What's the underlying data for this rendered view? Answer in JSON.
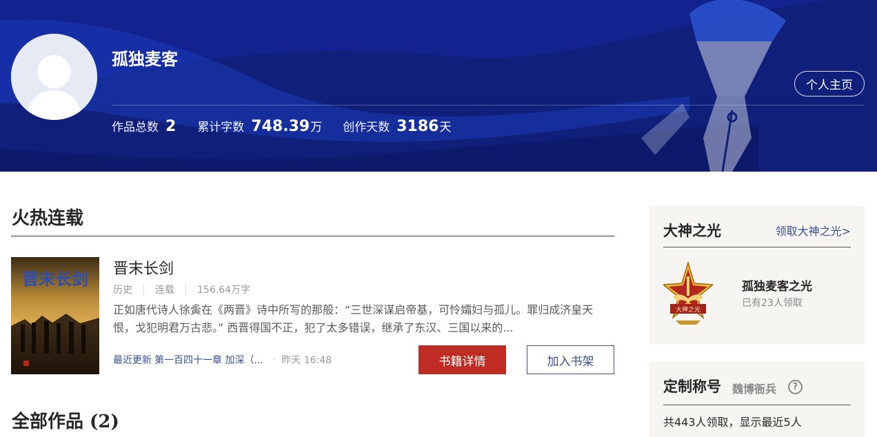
{
  "author": {
    "name": "孤独麦客",
    "home_button": "个人主页",
    "stats": [
      {
        "label": "作品总数",
        "value": "2",
        "unit": ""
      },
      {
        "label": "累计字数",
        "value": "748.39",
        "unit": "万"
      },
      {
        "label": "创作天数",
        "value": "3186",
        "unit": "天"
      }
    ]
  },
  "hot": {
    "title": "火热连载",
    "book": {
      "title": "晋末长剑",
      "category": "历史",
      "status": "连载",
      "words": "156.64万字",
      "description": "正如唐代诗人徐夤在《两晋》诗中所写的那般：“三世深谋启帝基，可怜孀妇与孤儿。罪归成济皇天恨，戈犯明君万古悲。” 西晋得国不正，犯了太多错误，继承了东汉、三国以来的...",
      "update_label": "最近更新",
      "update_chapter": "第一百四十一章 加深（...",
      "update_dot": "·",
      "update_time": "昨天 16:48",
      "detail_button": "书籍详情",
      "shelf_button": "加入书架",
      "cover_text": "晋末长剑"
    }
  },
  "all_works": {
    "title": "全部作品 (2)"
  },
  "sidebar": {
    "glory": {
      "title": "大神之光",
      "link": "领取大神之光>",
      "badge_name": "孤独麦客之光",
      "badge_count": "已有23人领取",
      "badge_text": "大神之光"
    },
    "custom": {
      "title": "定制称号",
      "sub_name": "魏博衙兵",
      "help": "?",
      "summary": "共443人领取，显示最近5人"
    }
  },
  "colors": {
    "banner_bg": "#0f1f7a",
    "accent_red": "#bf2c24",
    "link_blue": "#3c4f8a"
  }
}
